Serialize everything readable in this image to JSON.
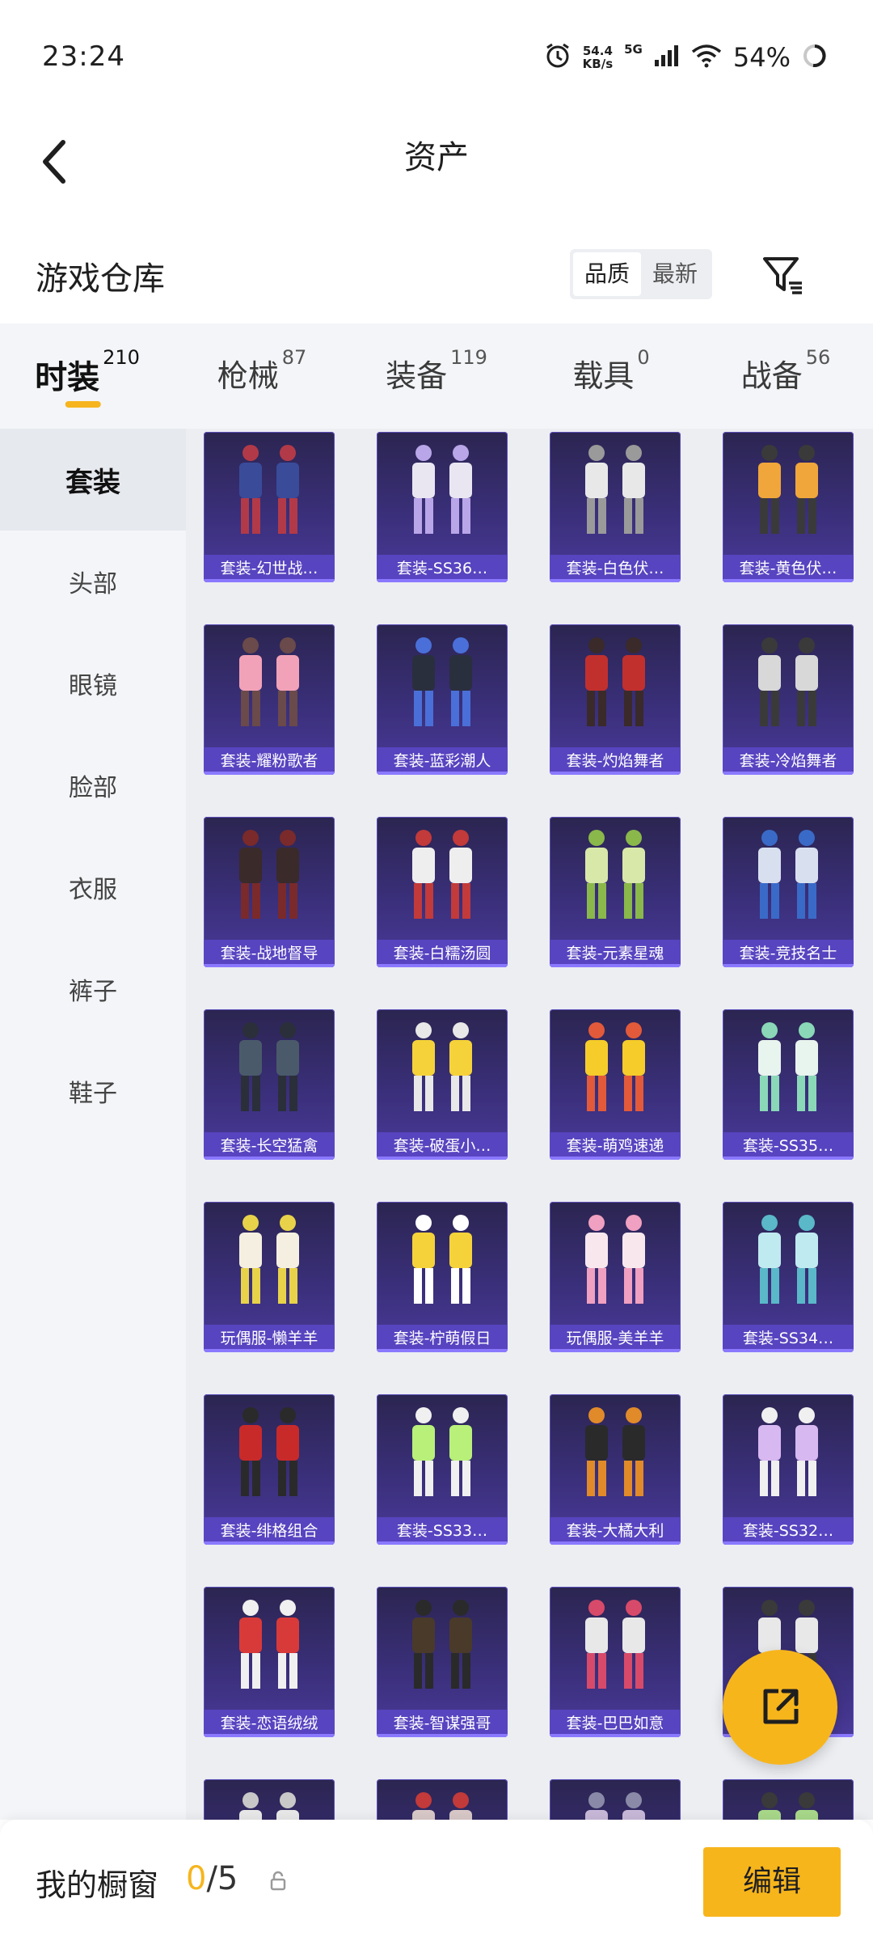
{
  "status_bar": {
    "time": "23:24",
    "net_speed_value": "54.4",
    "net_speed_unit": "KB/s",
    "network": "5G",
    "battery": "54%"
  },
  "header": {
    "title": "资产"
  },
  "warehouse": {
    "title": "游戏仓库",
    "sort_options": [
      "品质",
      "最新"
    ],
    "selected_sort": "品质"
  },
  "tabs": [
    {
      "label": "时装",
      "count": "210",
      "active": true
    },
    {
      "label": "枪械",
      "count": "87",
      "active": false
    },
    {
      "label": "装备",
      "count": "119",
      "active": false
    },
    {
      "label": "载具",
      "count": "0",
      "active": false
    },
    {
      "label": "战备",
      "count": "56",
      "active": false
    }
  ],
  "sidebar": {
    "items": [
      "套装",
      "头部",
      "眼镜",
      "脸部",
      "衣服",
      "裤子",
      "鞋子"
    ],
    "active": "套装"
  },
  "items": [
    {
      "label": "套装-幻世战…",
      "palette": [
        "#3a4b9a",
        "#b23a48"
      ]
    },
    {
      "label": "套装-SS36…",
      "palette": [
        "#e9e6f2",
        "#b9a6e8"
      ]
    },
    {
      "label": "套装-白色伏…",
      "palette": [
        "#e8e8e8",
        "#9a9a9a"
      ]
    },
    {
      "label": "套装-黄色伏…",
      "palette": [
        "#f0a63a",
        "#3a3a3a"
      ]
    },
    {
      "label": "套装-耀粉歌者",
      "palette": [
        "#f2a2b8",
        "#6a4a4a"
      ]
    },
    {
      "label": "套装-蓝彩潮人",
      "palette": [
        "#2a2f3e",
        "#4a6fd8"
      ]
    },
    {
      "label": "套装-灼焰舞者",
      "palette": [
        "#c2302e",
        "#3a2a2a"
      ]
    },
    {
      "label": "套装-冷焰舞者",
      "palette": [
        "#d8d8d8",
        "#3a3a3a"
      ]
    },
    {
      "label": "套装-战地督导",
      "palette": [
        "#3a2a2a",
        "#7a2a2a"
      ]
    },
    {
      "label": "套装-白糯汤圆",
      "palette": [
        "#eeeeee",
        "#c23a3a"
      ]
    },
    {
      "label": "套装-元素星魂",
      "palette": [
        "#d8e8a8",
        "#8ab84a"
      ]
    },
    {
      "label": "套装-竞技名士",
      "palette": [
        "#d8e0f0",
        "#3a6ac8"
      ]
    },
    {
      "label": "套装-长空猛禽",
      "palette": [
        "#4a5a6a",
        "#2a2f3a"
      ]
    },
    {
      "label": "套装-破蛋小…",
      "palette": [
        "#f6d23a",
        "#e8e8e8"
      ]
    },
    {
      "label": "套装-萌鸡速递",
      "palette": [
        "#f6cc2a",
        "#e25a3a"
      ]
    },
    {
      "label": "套装-SS35…",
      "palette": [
        "#e8f4ee",
        "#8ad8b8"
      ]
    },
    {
      "label": "玩偶服-懒羊羊",
      "palette": [
        "#f4efe0",
        "#e8d24a"
      ]
    },
    {
      "label": "套装-柠萌假日",
      "palette": [
        "#f6d23a",
        "#ffffff"
      ]
    },
    {
      "label": "玩偶服-美羊羊",
      "palette": [
        "#f8e8ee",
        "#f0a0c0"
      ]
    },
    {
      "label": "套装-SS34…",
      "palette": [
        "#bfeaf0",
        "#5ab8c8"
      ]
    },
    {
      "label": "套装-绯格组合",
      "palette": [
        "#c82a2a",
        "#2a2a2a"
      ]
    },
    {
      "label": "套装-SS33…",
      "palette": [
        "#b8f07a",
        "#f0f0f0"
      ]
    },
    {
      "label": "套装-大橘大利",
      "palette": [
        "#2a2a2a",
        "#e08a2a"
      ]
    },
    {
      "label": "套装-SS32…",
      "palette": [
        "#d8b8f0",
        "#f0f0f0"
      ]
    },
    {
      "label": "套装-恋语绒绒",
      "palette": [
        "#d83a3a",
        "#f0f0f0"
      ]
    },
    {
      "label": "套装-智谋强哥",
      "palette": [
        "#4a3a2a",
        "#2a2a2a"
      ]
    },
    {
      "label": "套装-巴巴如意",
      "palette": [
        "#e8e8e8",
        "#d84a6a"
      ]
    },
    {
      "label": "",
      "palette": [
        "#e8e8e8",
        "#3a3a3a"
      ]
    },
    {
      "label": "",
      "palette": [
        "#e8e8e8",
        "#c8c8c8"
      ]
    },
    {
      "label": "",
      "palette": [
        "#d8c8c8",
        "#c23a3a"
      ]
    },
    {
      "label": "",
      "palette": [
        "#c8b8d8",
        "#8a8aa8"
      ]
    },
    {
      "label": "",
      "palette": [
        "#a8d88a",
        "#3a3a3a"
      ]
    }
  ],
  "bottom_bar": {
    "label": "我的橱窗",
    "count_current": "0",
    "count_total": "/5",
    "edit_label": "编辑"
  },
  "colors": {
    "accent": "#f7b51c",
    "card_bg": "#3a2f7a",
    "card_label": "#5a46c8"
  },
  "icons": {
    "back": "chevron-left-icon",
    "filter": "filter-icon",
    "share": "share-external-icon",
    "lock": "lock-icon",
    "alarm": "alarm-icon",
    "signal": "signal-icon",
    "wifi": "wifi-icon",
    "battery": "battery-ring-icon"
  }
}
